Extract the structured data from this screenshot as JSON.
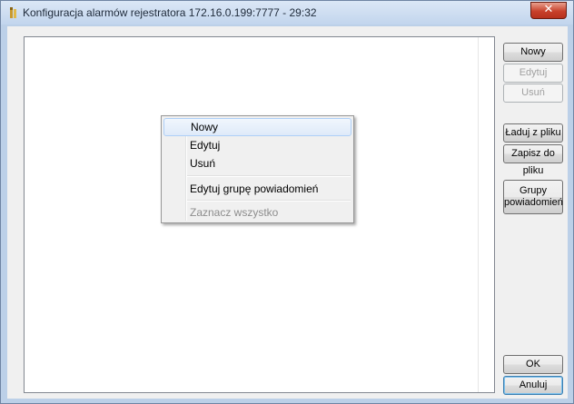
{
  "window": {
    "title": "Konfiguracja alarmów rejestratora 172.16.0.199:7777 - 29:32",
    "close_label": "✕"
  },
  "buttons": {
    "new": "Nowy",
    "edit": "Edytuj",
    "delete": "Usuń",
    "load_from_file": "Ładuj z pliku",
    "save_to_file": "Zapisz do pliku",
    "notification_groups": "Grupy powiadomień",
    "ok": "OK",
    "cancel": "Anuluj"
  },
  "context_menu": {
    "items": [
      {
        "label": "Nowy",
        "enabled": true,
        "hovered": true
      },
      {
        "label": "Edytuj",
        "enabled": true
      },
      {
        "label": "Usuń",
        "enabled": true
      },
      {
        "label": "Edytuj grupę powiadomień",
        "enabled": true
      },
      {
        "label": "Zaznacz wszystko",
        "enabled": false
      }
    ]
  },
  "colors": {
    "title_bar": "#c2d5ed",
    "close_button": "#c8412b",
    "menu_highlight": "#dfeaf9"
  }
}
